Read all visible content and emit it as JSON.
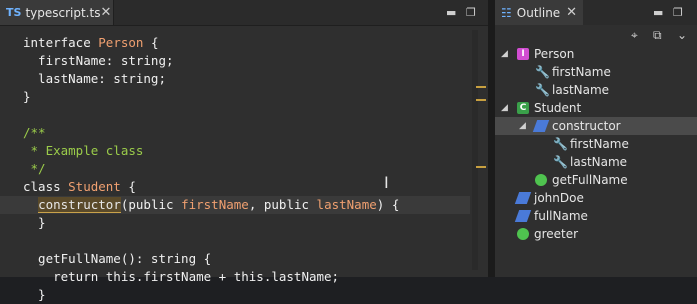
{
  "editor": {
    "tab_prefix": "TS",
    "tab_label": "typescript.ts",
    "close_glyph": "X",
    "code_lines": [
      {
        "tokens": [
          {
            "t": "interface ",
            "c": "kw"
          },
          {
            "t": "Person",
            "c": "ty"
          },
          {
            "t": " {",
            "c": "kw"
          }
        ]
      },
      {
        "tokens": [
          {
            "t": "  firstName: string;",
            "c": "kw"
          }
        ]
      },
      {
        "tokens": [
          {
            "t": "  lastName: string;",
            "c": "kw"
          }
        ]
      },
      {
        "tokens": [
          {
            "t": "}",
            "c": "kw"
          }
        ]
      },
      {
        "tokens": [
          {
            "t": "",
            "c": "kw"
          }
        ]
      },
      {
        "tokens": [
          {
            "t": "/**",
            "c": "cm"
          }
        ]
      },
      {
        "tokens": [
          {
            "t": " * Example class",
            "c": "cm"
          }
        ]
      },
      {
        "tokens": [
          {
            "t": " */",
            "c": "cm"
          }
        ]
      },
      {
        "tokens": [
          {
            "t": "class ",
            "c": "kw"
          },
          {
            "t": "Student",
            "c": "ty"
          },
          {
            "t": " {",
            "c": "kw"
          }
        ]
      },
      {
        "current": true,
        "tokens": [
          {
            "t": "  ",
            "c": "kw"
          },
          {
            "t": "constructor",
            "c": "hl"
          },
          {
            "t": "(public ",
            "c": "kw"
          },
          {
            "t": "firstName",
            "c": "pm"
          },
          {
            "t": ", public ",
            "c": "kw"
          },
          {
            "t": "lastName",
            "c": "pm"
          },
          {
            "t": ") {",
            "c": "kw"
          }
        ]
      },
      {
        "tokens": [
          {
            "t": "  }",
            "c": "kw"
          }
        ]
      },
      {
        "tokens": [
          {
            "t": "",
            "c": "kw"
          }
        ]
      },
      {
        "tokens": [
          {
            "t": "  getFullName(): string {",
            "c": "kw"
          }
        ]
      },
      {
        "tokens": [
          {
            "t": "    return this.firstName + this.lastName;",
            "c": "kw"
          }
        ]
      },
      {
        "tokens": [
          {
            "t": "  }",
            "c": "kw"
          }
        ]
      }
    ]
  },
  "outline": {
    "tab_label": "Outline",
    "tab_icon": "outline-icon",
    "close_glyph": "X",
    "nodes": [
      {
        "label": "Person",
        "icon": "interface",
        "indent": 0,
        "expanded": true
      },
      {
        "label": "firstName",
        "icon": "field",
        "indent": 1
      },
      {
        "label": "lastName",
        "icon": "field",
        "indent": 1
      },
      {
        "label": "Student",
        "icon": "class",
        "indent": 0,
        "expanded": true
      },
      {
        "label": "constructor",
        "icon": "var",
        "indent": 1,
        "expanded": true,
        "selected": true
      },
      {
        "label": "firstName",
        "icon": "field",
        "indent": 2
      },
      {
        "label": "lastName",
        "icon": "field",
        "indent": 2
      },
      {
        "label": "getFullName",
        "icon": "method",
        "indent": 1
      },
      {
        "label": "johnDoe",
        "icon": "var",
        "indent": 0
      },
      {
        "label": "fullName",
        "icon": "var",
        "indent": 0
      },
      {
        "label": "greeter",
        "icon": "method",
        "indent": 0
      }
    ]
  }
}
